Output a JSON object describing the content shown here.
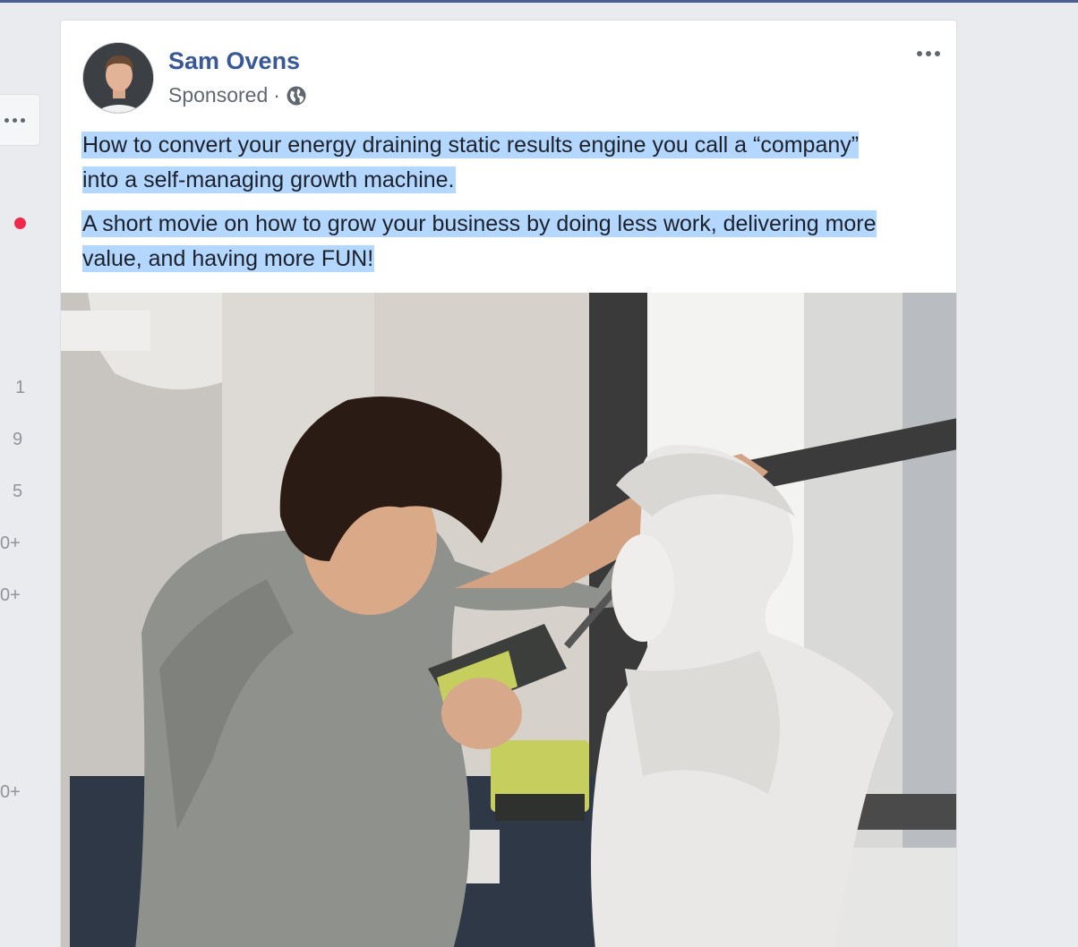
{
  "sidebar": {
    "counts": [
      "1",
      "9",
      "5",
      "0+",
      "0+",
      "0+"
    ]
  },
  "post": {
    "author": "Sam Ovens",
    "sponsored_label": "Sponsored",
    "separator": "·",
    "paragraphs": [
      "How to convert your energy draining static results engine you call a “company” into a self-managing growth machine.",
      "A short movie on how to grow your business by doing less work, delivering more value, and having more FUN!"
    ],
    "icons": {
      "privacy": "globe-icon",
      "options": "more-horizontal-icon"
    }
  },
  "colors": {
    "author_link": "#385898",
    "selection": "#b3d7ff",
    "notification_dot": "#f02849"
  }
}
